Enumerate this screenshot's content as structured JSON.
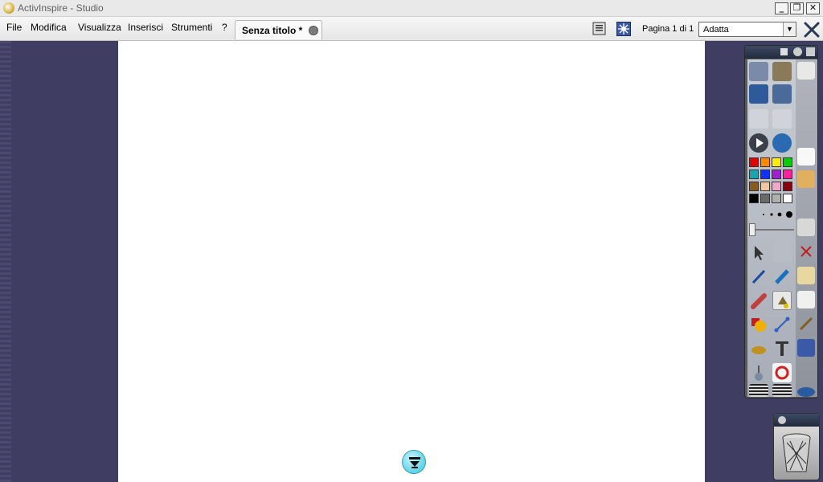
{
  "window": {
    "title": "ActivInspire - Studio",
    "buttons": {
      "minimize": "_",
      "restore": "❐",
      "close": "✕"
    }
  },
  "menu": {
    "items": [
      "File",
      "Modifica",
      "Visualizza",
      "Inserisci",
      "Strumenti",
      "?"
    ]
  },
  "document_tab": {
    "label": "Senza titolo *"
  },
  "pagination": {
    "label": "Pagina 1 di 1"
  },
  "zoom": {
    "selected": "Adatta"
  },
  "toolbox": {
    "color_swatches": [
      "#e00000",
      "#ff8a00",
      "#ffee00",
      "#00d000",
      "#1aa4b0",
      "#1030ff",
      "#a020d0",
      "#ff20a0",
      "#8a5a20",
      "#f0c8a0",
      "#f0a8c8",
      "#8a0010",
      "#000000",
      "#6a6a6a",
      "#b0b0b0",
      "#ffffff"
    ],
    "tools": [
      "flipchart-browser-icon",
      "resource-library-icon",
      "page-browser-icon",
      "properties-icon",
      "previous-page-icon",
      "next-page-icon",
      "play-icon",
      "web-browser-icon",
      "select-icon",
      "magic-ink-icon",
      "pen-icon",
      "highlighter-icon",
      "eraser-icon",
      "fill-icon",
      "shape-icon",
      "connector-icon",
      "marquee-icon",
      "text-icon",
      "clear-icon",
      "undo-icon",
      "scroll-icon",
      "lasso-icon"
    ]
  }
}
